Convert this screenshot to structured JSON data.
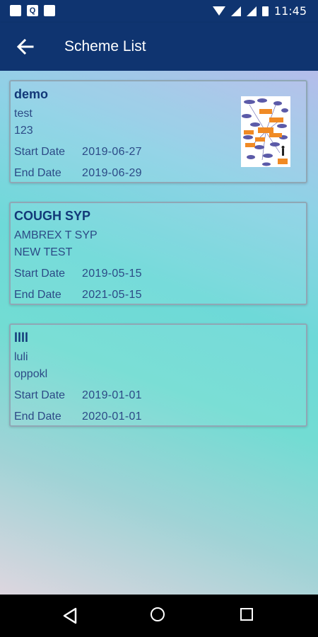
{
  "status_bar": {
    "time": "11:45",
    "left_icons": [
      "sim-card-icon",
      "q-app-icon",
      "image-icon"
    ],
    "right_icons": [
      "wifi-icon",
      "signal-icon",
      "signal-icon",
      "battery-icon"
    ],
    "q_label": "Q"
  },
  "app_bar": {
    "title": "Scheme List",
    "back_icon": "arrow-left-icon",
    "color": "#0f3470"
  },
  "schemes": [
    {
      "name": "demo",
      "line1": "test",
      "line2": "123",
      "start_label": "Start Date",
      "start_date": "2019-06-27",
      "end_label": "End Date",
      "end_date": "2019-06-29",
      "has_thumbnail": true
    },
    {
      "name": "COUGH SYP",
      "line1": "AMBREX T SYP",
      "line2": "NEW TEST",
      "start_label": "Start Date",
      "start_date": "2019-05-15",
      "end_label": "End Date",
      "end_date": "2021-05-15",
      "has_thumbnail": false
    },
    {
      "name": "llll",
      "line1": "luli",
      "line2": "oppokl",
      "start_label": "Start Date",
      "start_date": "2019-01-01",
      "end_label": "End Date",
      "end_date": "2020-01-01",
      "has_thumbnail": false
    }
  ],
  "nav_bar": {
    "icons": [
      "nav-back-icon",
      "nav-home-icon",
      "nav-recents-icon"
    ]
  }
}
